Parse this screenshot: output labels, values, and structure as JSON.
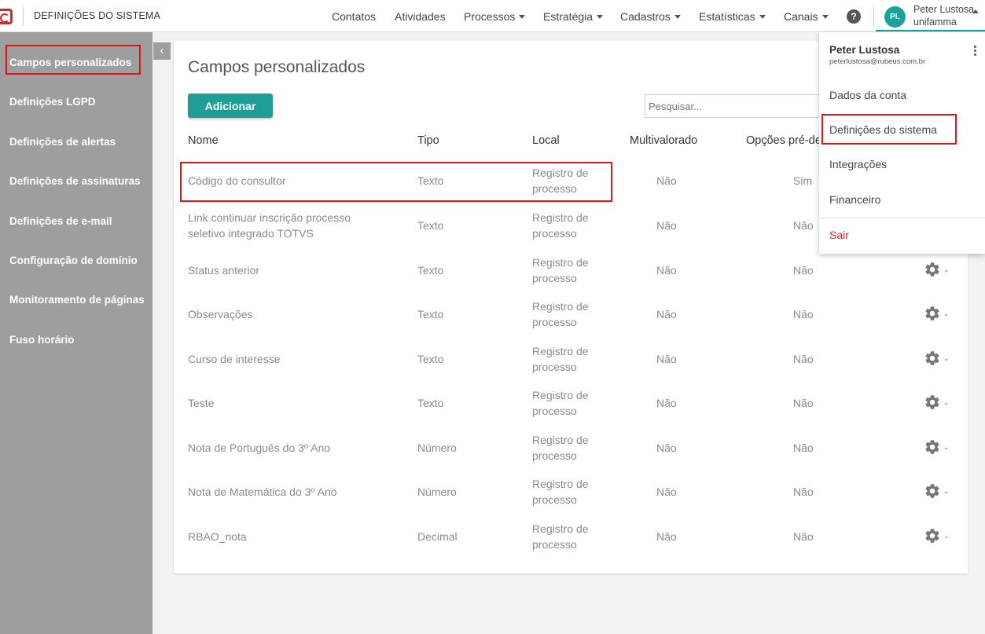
{
  "app": {
    "title": "DEFINIÇÕES DO SISTEMA"
  },
  "nav": {
    "items": [
      {
        "label": "Contatos",
        "dropdown": false
      },
      {
        "label": "Atividades",
        "dropdown": false
      },
      {
        "label": "Processos",
        "dropdown": true
      },
      {
        "label": "Estratégia",
        "dropdown": true
      },
      {
        "label": "Cadastros",
        "dropdown": true
      },
      {
        "label": "Estatísticas",
        "dropdown": true
      },
      {
        "label": "Canais",
        "dropdown": true
      }
    ],
    "help_symbol": "?"
  },
  "user": {
    "initials": "PL",
    "name": "Peter Lustosa",
    "org": "unifamma",
    "email": "peterlustosa@rubeus.com.br"
  },
  "user_menu": {
    "items": [
      "Dados da conta",
      "Definições do sistema",
      "Integrações",
      "Financeiro"
    ],
    "logout": "Sair"
  },
  "sidebar": {
    "items": [
      "Campos personalizados",
      "Definições LGPD",
      "Definições de alertas",
      "Definições de assinaturas",
      "Definições de e-mail",
      "Configuração de domínio",
      "Monitoramento de páginas",
      "Fuso horário"
    ]
  },
  "main": {
    "title": "Campos personalizados",
    "add_label": "Adicionar",
    "search_placeholder": "Pesquisar...",
    "columns": [
      "Nome",
      "Tipo",
      "Local",
      "Multivalorado",
      "Opções pré-de"
    ],
    "rows": [
      {
        "nome": [
          "Código do consultor"
        ],
        "tipo": "Texto",
        "local": [
          "Registro de",
          "processo"
        ],
        "multi": "Não",
        "opcoes": "Sim"
      },
      {
        "nome": [
          "Link continuar inscrição processo",
          "seletivo integrado TOTVS"
        ],
        "tipo": "Texto",
        "local": [
          "Registro de",
          "processo"
        ],
        "multi": "Não",
        "opcoes": "Não"
      },
      {
        "nome": [
          "Status anterior"
        ],
        "tipo": "Texto",
        "local": [
          "Registro de",
          "processo"
        ],
        "multi": "Não",
        "opcoes": "Não"
      },
      {
        "nome": [
          "Observações"
        ],
        "tipo": "Texto",
        "local": [
          "Registro de",
          "processo"
        ],
        "multi": "Não",
        "opcoes": "Não"
      },
      {
        "nome": [
          "Curso de interesse"
        ],
        "tipo": "Texto",
        "local": [
          "Registro de",
          "processo"
        ],
        "multi": "Não",
        "opcoes": "Não"
      },
      {
        "nome": [
          "Teste"
        ],
        "tipo": "Texto",
        "local": [
          "Registro de",
          "processo"
        ],
        "multi": "Não",
        "opcoes": "Não"
      },
      {
        "nome": [
          "Nota de Português do 3º Ano"
        ],
        "tipo": "Número",
        "local": [
          "Registro de",
          "processo"
        ],
        "multi": "Não",
        "opcoes": "Não"
      },
      {
        "nome": [
          "Nota de Matemática do 3º Ano"
        ],
        "tipo": "Número",
        "local": [
          "Registro de",
          "processo"
        ],
        "multi": "Não",
        "opcoes": "Não"
      },
      {
        "nome": [
          "RBAO_nota"
        ],
        "tipo": "Decimal",
        "local": [
          "Registro de",
          "processo"
        ],
        "multi": "Não",
        "opcoes": "Não"
      }
    ]
  },
  "colors": {
    "accent": "#1f9e98",
    "sidebar": "#9e9e9e",
    "highlight": "#e01414",
    "logout": "#e02020"
  }
}
